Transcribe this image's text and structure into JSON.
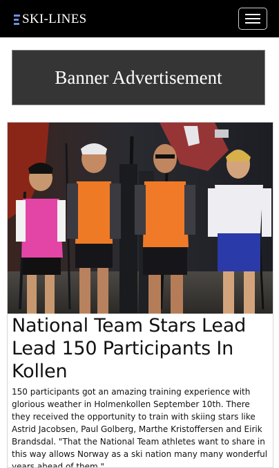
{
  "header": {
    "logo_text": "SKI-LINES",
    "logo_accent_color": "#6f8fe0",
    "menu_icon": "hamburger-menu-icon"
  },
  "banner": {
    "text": "Banner Advertisement"
  },
  "article": {
    "image": "team-photo",
    "headline": "National Team Stars Lead Lead 150 Participants In Kollen",
    "summary": "150 participants got an amazing training experience with glorious weather in Holmenkollen September 10th. There they received the opportunity to train with skiing stars like Astrid Jacobsen, Paul Golberg, Marthe Kristoffersen and Eirik Brandsdal. \"That the National Team athletes want to share in this way allows Norway as a ski nation many many wonderful years ahead of them.\""
  }
}
